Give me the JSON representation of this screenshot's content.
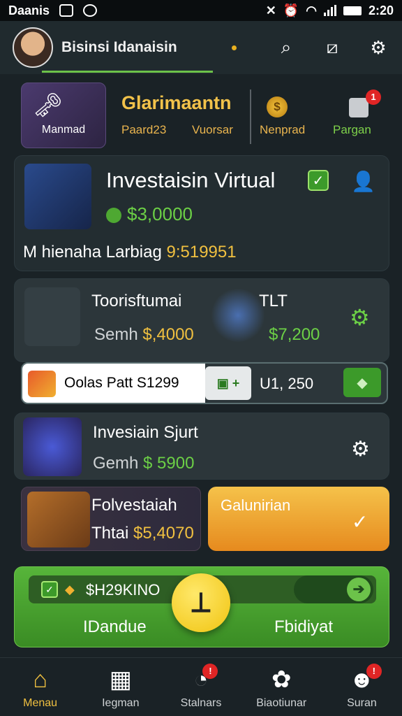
{
  "status_bar": {
    "carrier": "Daanis",
    "time": "2:20"
  },
  "header": {
    "title": "Bisinsi Idanaisin",
    "icons": [
      "search-icon",
      "edit-icon",
      "gear-icon"
    ]
  },
  "feature": {
    "tile_label": "Manmad",
    "title": "Glarimaantn",
    "sub1": "Paard23",
    "sub2": "Vuorsar",
    "coin_label": "Nenprad",
    "bag_label": "Pargan",
    "bag_badge": "1"
  },
  "card1": {
    "title": "Investaisin Virtual",
    "amount": "$3,0000",
    "note_prefix": "M hienaha Larbiag",
    "note_value": "9:519951"
  },
  "card2": {
    "title": "Toorisftumai",
    "sub_label": "Semh",
    "sub_value": "$,4000",
    "tag": "TLT",
    "amount": "$7,200"
  },
  "bar": {
    "text": "Oolas Patt S1299",
    "value": "U1, 250"
  },
  "card3": {
    "title": "Invesiain Sjurt",
    "sub_label": "Gemh",
    "sub_value": "$ 5900"
  },
  "card4": {
    "title": "Folvestaiah",
    "sub_label": "Thtai",
    "sub_value": "$5,4070"
  },
  "card5": {
    "title": "Galunirian"
  },
  "green_panel": {
    "code": "$H29KINO",
    "left_label": "IDandue",
    "right_label": "Fbidiyat"
  },
  "nav": [
    {
      "label": "Menau",
      "icon": "home-icon",
      "active": true
    },
    {
      "label": "Iegman",
      "icon": "calendar-icon"
    },
    {
      "label": "Stalnars",
      "icon": "chart-icon",
      "badge": "!"
    },
    {
      "label": "Biaotiunar",
      "icon": "puzzle-icon"
    },
    {
      "label": "Suran",
      "icon": "profile-icon",
      "badge": "!"
    }
  ],
  "colors": {
    "accent_green": "#6cc24a",
    "gold": "#f0c040",
    "badge_red": "#e02525",
    "background": "#1a2226"
  }
}
